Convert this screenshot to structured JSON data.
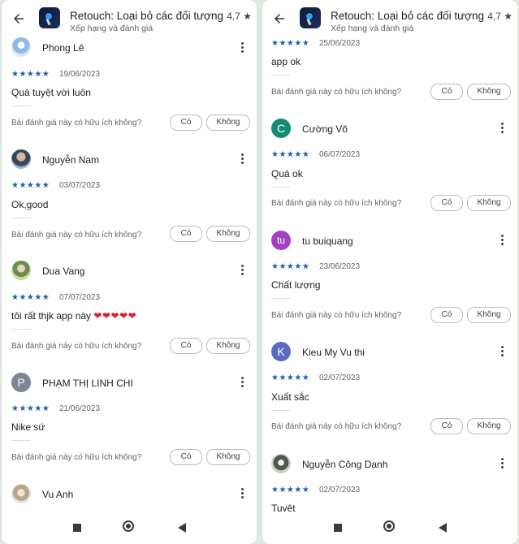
{
  "app": {
    "title": "Retouch: Loại bỏ các đối tượng",
    "rating": "4,7 ★",
    "subtitle": "Xếp hạng và đánh giá",
    "helpful_question": "Bài đánh giá này có hữu ích không?",
    "yes_label": "Có",
    "no_label": "Không",
    "stars": "★★★★★"
  },
  "left_reviews": [
    {
      "name": "Phong Lê",
      "date": "19/06/2023",
      "text": "Quá tuyệt vời luôn"
    },
    {
      "name": "Nguyễn Nam",
      "date": "03/07/2023",
      "text": "Ok,good"
    },
    {
      "name": "Dua Vang",
      "date": "07/07/2023",
      "text": "tôi rất thjk app này",
      "hearts": "❤❤❤❤❤"
    },
    {
      "name": "PHẠM THỊ LINH CHI",
      "avatar_letter": "P",
      "avatar_color": "#7b8794",
      "date": "21/06/2023",
      "text": "Nike sứ"
    },
    {
      "name": "Vu Anh"
    }
  ],
  "right_reviews": [
    {
      "date": "25/06/2023",
      "text": "app ok"
    },
    {
      "name": "Cường Võ",
      "avatar_letter": "C",
      "avatar_color": "#138a72",
      "date": "06/07/2023",
      "text": "Quá ok"
    },
    {
      "name": "tu buiquang",
      "avatar_letter": "tu",
      "avatar_color": "#a142c4",
      "date": "23/06/2023",
      "text": "Chất lượng"
    },
    {
      "name": "Kieu My Vu thi",
      "avatar_letter": "K",
      "avatar_color": "#5c6bc0",
      "date": "02/07/2023",
      "text": "Xuất sắc"
    },
    {
      "name": "Nguyễn Công Danh",
      "date": "02/07/2023",
      "text": "Tuyệt"
    }
  ],
  "icons": [
    "back-arrow-icon",
    "app-icon",
    "more-vert-icon",
    "nav-recents-icon",
    "nav-home-icon",
    "nav-back-icon"
  ]
}
